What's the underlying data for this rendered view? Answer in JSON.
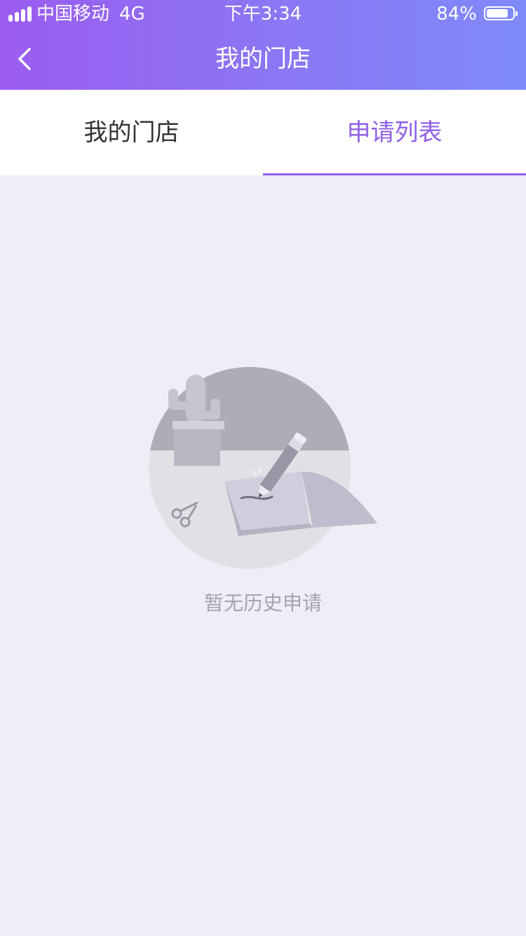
{
  "status_bar": {
    "carrier": "中国移动",
    "network": "4G",
    "time": "下午3:34",
    "battery": "84%",
    "battery_level": 0.84
  },
  "navbar": {
    "title": "我的门店",
    "back_icon": "chevron-left-icon"
  },
  "tabs": [
    {
      "label": "我的门店",
      "active": false
    },
    {
      "label": "申请列表",
      "active": true
    }
  ],
  "empty_state": {
    "message": "暂无历史申请",
    "illustration": "empty-desk-illustration"
  },
  "colors": {
    "header_gradient_start": "#9b5cf0",
    "header_gradient_end": "#7f8afa",
    "accent": "#9060e8",
    "background": "#eeeef6",
    "empty_text": "#a4a4ae"
  }
}
